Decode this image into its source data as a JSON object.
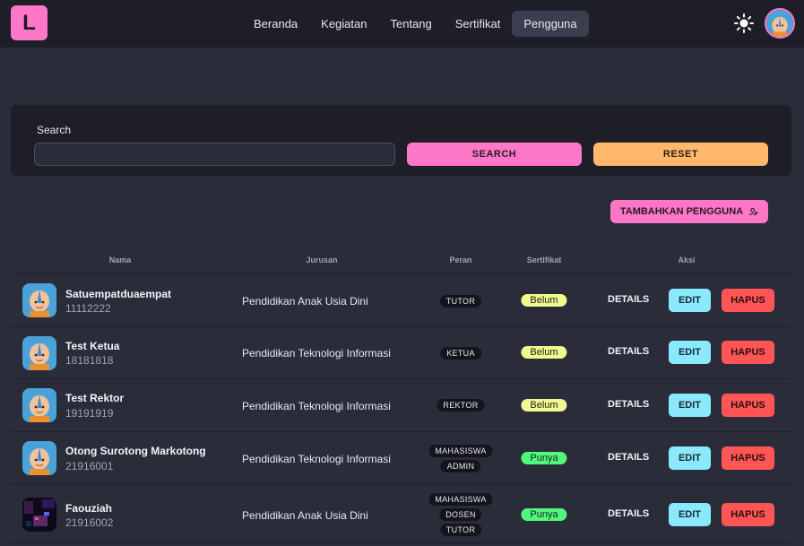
{
  "brand": {
    "logo_letter": "L"
  },
  "nav": {
    "items": [
      {
        "label": "Beranda",
        "active": false
      },
      {
        "label": "Kegiatan",
        "active": false
      },
      {
        "label": "Tentang",
        "active": false
      },
      {
        "label": "Sertifikat",
        "active": false
      },
      {
        "label": "Pengguna",
        "active": true
      }
    ]
  },
  "search": {
    "label": "Search",
    "value": "",
    "placeholder": "",
    "search_button": "SEARCH",
    "reset_button": "RESET"
  },
  "add_button": {
    "label": "TAMBAHKAN PENGGUNA"
  },
  "table": {
    "headers": {
      "nama": "Nama",
      "jurusan": "Jurusan",
      "peran": "Peran",
      "sertifikat": "Sertifikat",
      "aksi": "Aksi"
    },
    "rows": [
      {
        "avatar": "aang-avatar",
        "name": "Satuempatduaempat",
        "nim": "11112222",
        "jurusan": "Pendidikan Anak Usia Dini",
        "roles": [
          "TUTOR"
        ],
        "sertifikat": "Belum",
        "details": "DETAILS",
        "edit": "EDIT",
        "hapus": "HAPUS"
      },
      {
        "avatar": "aang-avatar",
        "name": "Test Ketua",
        "nim": "18181818",
        "jurusan": "Pendidikan Teknologi Informasi",
        "roles": [
          "KETUA"
        ],
        "sertifikat": "Belum",
        "details": "DETAILS",
        "edit": "EDIT",
        "hapus": "HAPUS"
      },
      {
        "avatar": "aang-avatar",
        "name": "Test Rektor",
        "nim": "19191919",
        "jurusan": "Pendidikan Teknologi Informasi",
        "roles": [
          "REKTOR"
        ],
        "sertifikat": "Belum",
        "details": "DETAILS",
        "edit": "EDIT",
        "hapus": "HAPUS"
      },
      {
        "avatar": "aang-avatar",
        "name": "Otong Surotong Markotong",
        "nim": "21916001",
        "jurusan": "Pendidikan Teknologi Informasi",
        "roles": [
          "MAHASISWA",
          "ADMIN"
        ],
        "sertifikat": "Punya",
        "details": "DETAILS",
        "edit": "EDIT",
        "hapus": "HAPUS"
      },
      {
        "avatar": "dark-scene-avatar",
        "name": "Faouziah",
        "nim": "21916002",
        "jurusan": "Pendidikan Anak Usia Dini",
        "roles": [
          "MAHASISWA",
          "DOSEN",
          "TUTOR"
        ],
        "sertifikat": "Punya",
        "details": "DETAILS",
        "edit": "EDIT",
        "hapus": "HAPUS"
      }
    ]
  },
  "colors": {
    "accent": "#ff77c6",
    "reset": "#ffb86c",
    "edit": "#8be9fd",
    "hapus": "#ff5555",
    "belum": "#f1fa8c",
    "punya": "#50fa7b"
  },
  "icons": {
    "theme": "sun-icon",
    "add": "user-plus-icon"
  }
}
